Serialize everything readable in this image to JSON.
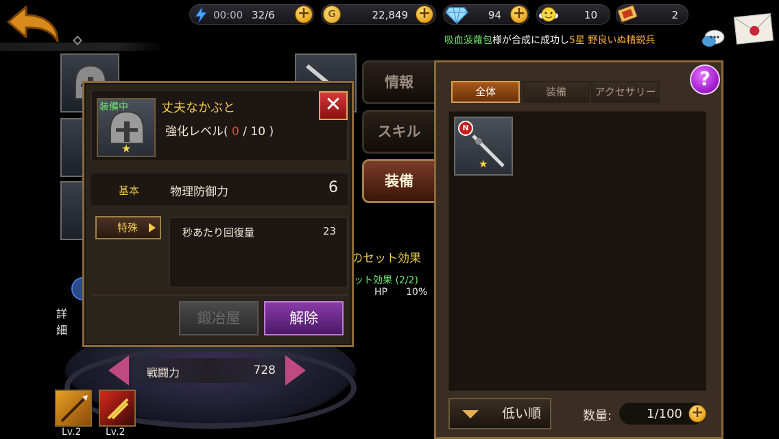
{
  "topbar": {
    "energy_timer": "00:00",
    "energy_count": "32/6",
    "gold": "22,849",
    "gems": "94",
    "friend_points": "10",
    "tickets": "2"
  },
  "notice": {
    "player": "吸血菠蘿包",
    "middle": "様が合成に成功し",
    "result": "5星 野良いぬ精鋭兵"
  },
  "side_tabs": [
    "情報",
    "スキル",
    "装備"
  ],
  "set_effect": {
    "title_fragment": "のセット効果",
    "effect_fragment": "ット効果 (2/2)",
    "hp_label": "HP",
    "hp_value": "10%"
  },
  "details_label": "詳細",
  "combat": {
    "label": "戦闘力",
    "value": "728"
  },
  "skills": [
    {
      "level": "Lv.2"
    },
    {
      "level": "Lv.2"
    }
  ],
  "dialog": {
    "equipped_tag": "装備中",
    "item_name": "丈夫なかぶと",
    "enhance_prefix": "強化レベル(",
    "enhance_current": "0",
    "enhance_suffix": "/ 10 )",
    "basic_label": "基本",
    "basic_stat": "物理防御力",
    "basic_value": "6",
    "special_label": "特殊",
    "special_stat": "秒あたり回復量",
    "special_value": "23",
    "forge_label": "鍛冶屋",
    "unequip_label": "解除"
  },
  "inventory": {
    "filters": [
      "全体",
      "装備",
      "アクセサリー"
    ],
    "active_filter": "全体",
    "new_badge": "N",
    "sort_label": "低い順",
    "qty_label": "数量:",
    "qty_value": "1/100",
    "help_label": "?"
  },
  "colors": {
    "gold_text": "#f0c64a",
    "accent_purple": "#9a18c8",
    "panel_border": "#8a6a3a",
    "green_text": "#6ee86e",
    "orange_text": "#ffae3a"
  }
}
